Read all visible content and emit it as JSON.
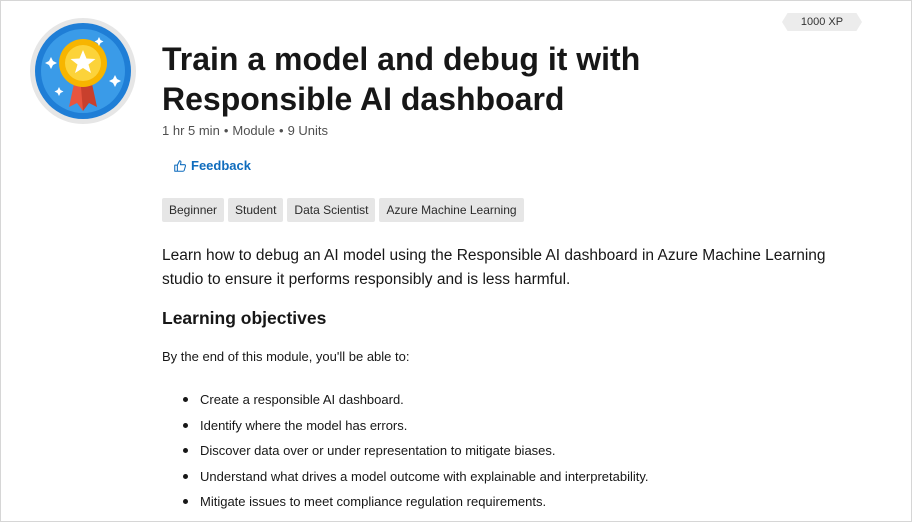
{
  "xp": "1000 XP",
  "title": "Train a model and debug it with Responsible AI dashboard",
  "meta": {
    "duration": "1 hr 5 min",
    "type": "Module",
    "units": "9 Units"
  },
  "feedback": {
    "label": "Feedback",
    "icon": "thumbs-up-icon"
  },
  "tags": [
    "Beginner",
    "Student",
    "Data Scientist",
    "Azure Machine Learning"
  ],
  "summary": "Learn how to debug an AI model using the Responsible AI dashboard in Azure Machine Learning studio to ensure it performs responsibly and is less harmful.",
  "objectives": {
    "heading": "Learning objectives",
    "intro": "By the end of this module, you'll be able to:",
    "items": [
      "Create a responsible AI dashboard.",
      "Identify where the model has errors.",
      "Discover data over or under representation to mitigate biases.",
      "Understand what drives a model outcome with explainable and interpretability.",
      "Mitigate issues to meet compliance regulation requirements."
    ]
  },
  "colors": {
    "accent": "#0f6cbd",
    "badge_blue": "#1f7ed6",
    "medal_gold": "#f7b500",
    "ribbon_red": "#e8553f"
  }
}
